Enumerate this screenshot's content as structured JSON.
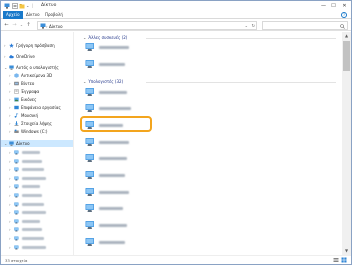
{
  "window": {
    "title": "Δίκτυο"
  },
  "titlebar": {
    "min": "—",
    "max": "☐",
    "close": "✕"
  },
  "ribbon": {
    "tabs": [
      "Αρχείο",
      "Δίκτυο",
      "Προβολή"
    ],
    "help": "?"
  },
  "address": {
    "path_separator": "›",
    "path": "Δίκτυο",
    "dropdown": "⌄",
    "refresh": "↻"
  },
  "nav": {
    "back": "←",
    "forward": "→",
    "up_dropdown": "⌄",
    "up": "↑",
    "quick_access": "Γρήγορη πρόσβαση",
    "onedrive": "OneDrive",
    "this_pc": "Αυτός ο υπολογιστής",
    "pc_children": [
      "Αντικείμενα 3D",
      "Βίντεο",
      "Έγγραφα",
      "Εικόνες",
      "Επιφάνεια εργασίας",
      "Μουσική",
      "Στοιχεία λήψης",
      "Windows (C:)"
    ],
    "network": "Δίκτυο"
  },
  "groups": {
    "other_devices": "Άλλες συσκευές (2)",
    "computers": "Υπολογιστές (32)"
  },
  "status": {
    "items": "33 στοιχεία"
  },
  "scroll": {
    "up": "▲",
    "down": "▼"
  },
  "colors": {
    "accent": "#1979ca",
    "highlight": "#f3a51e",
    "selection": "#cce8ff"
  }
}
